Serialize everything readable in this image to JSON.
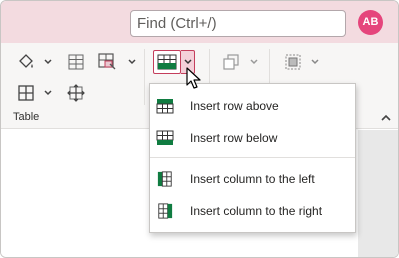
{
  "search": {
    "placeholder": "Find (Ctrl+/)"
  },
  "user": {
    "initials": "AB"
  },
  "ribbon": {
    "group_label": "Table",
    "icons": [
      "fill-color-icon",
      "cell-spacing-icon",
      "cell-properties-icon",
      "insert-table-icon",
      "copy-format-icon",
      "select-table-icon",
      "borders-icon",
      "move-table-icon"
    ]
  },
  "menu": {
    "items": [
      {
        "label": "Insert row above"
      },
      {
        "label": "Insert row below"
      },
      {
        "label": "Insert column to the left"
      },
      {
        "label": "Insert column to the right"
      }
    ]
  },
  "colors": {
    "accent": "#107c41",
    "titlebar": "#f3dbe0",
    "avatar": "#e5457c",
    "active_button": "#c43e5c"
  }
}
